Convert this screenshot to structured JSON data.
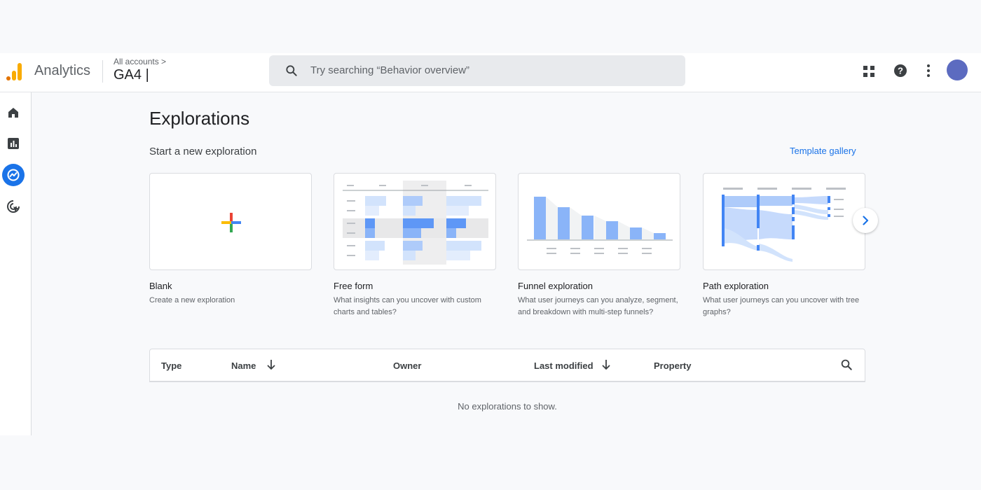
{
  "header": {
    "app_name": "Analytics",
    "account_breadcrumb": "All accounts",
    "property_name": "GA4 |",
    "search_placeholder": "Try searching “Behavior overview”",
    "icons": [
      "apps-grid-icon",
      "help-icon",
      "more-vert-icon",
      "avatar"
    ]
  },
  "colors": {
    "accent": "#1a73e8",
    "logo_orange": "#f9ab00",
    "logo_dark": "#e37400",
    "avatar": "#5c6bc0",
    "chart_blue": "#8ab4f8"
  },
  "sidebar": {
    "items": [
      {
        "name": "home",
        "icon": "home-icon"
      },
      {
        "name": "reports",
        "icon": "bar-chart-icon"
      },
      {
        "name": "explore",
        "icon": "explore-icon",
        "active": true
      },
      {
        "name": "advertising",
        "icon": "target-icon"
      }
    ]
  },
  "main": {
    "title": "Explorations",
    "subtitle": "Start a new exploration",
    "template_gallery_link": "Template gallery",
    "templates": [
      {
        "title": "Blank",
        "description": "Create a new exploration"
      },
      {
        "title": "Free form",
        "description": "What insights can you uncover with custom charts and tables?"
      },
      {
        "title": "Funnel exploration",
        "description": "What user journeys can you analyze, segment, and breakdown with multi-step funnels?"
      },
      {
        "title": "Path exploration",
        "description": "What user journeys can you uncover with tree graphs?"
      }
    ],
    "table": {
      "columns": [
        "Type",
        "Name",
        "Owner",
        "Last modified",
        "Property"
      ],
      "sorted_columns": [
        "Name",
        "Last modified"
      ],
      "empty_message": "No explorations to show."
    }
  }
}
